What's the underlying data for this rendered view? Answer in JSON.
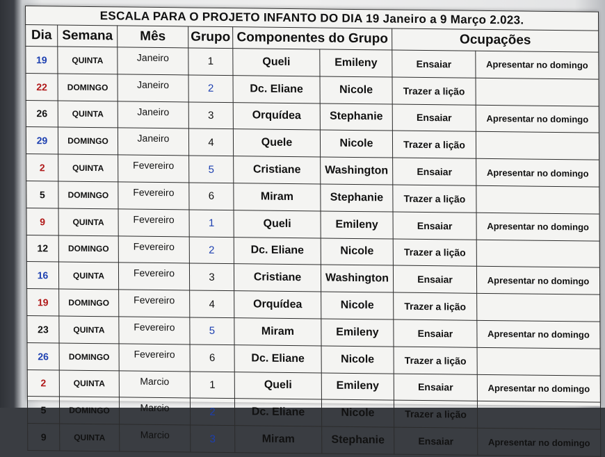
{
  "title": "ESCALA PARA O PROJETO INFANTO DO DIA 19 Janeiro a 9 Março 2.023.",
  "headers": {
    "dia": "Dia",
    "semana": "Semana",
    "mes": "Mês",
    "grupo": "Grupo",
    "componentes": "Componentes do Grupo",
    "ocupacoes": "Ocupações"
  },
  "rows": [
    {
      "dia": "19",
      "dia_color": "blue",
      "semana": "QUINTA",
      "mes": "Janeiro",
      "grupo": "1",
      "grupo_color": "black",
      "comp1": "Queli",
      "comp2": "Emileny",
      "acao": "Ensaiar",
      "apresentar": "Apresentar no domingo"
    },
    {
      "dia": "22",
      "dia_color": "red",
      "semana": "DOMINGO",
      "mes": "Janeiro",
      "grupo": "2",
      "grupo_color": "blue",
      "comp1": "Dc. Eliane",
      "comp2": "Nicole",
      "acao": "Trazer a lição",
      "apresentar": ""
    },
    {
      "dia": "26",
      "dia_color": "black",
      "semana": "QUINTA",
      "mes": "Janeiro",
      "grupo": "3",
      "grupo_color": "black",
      "comp1": "Orquídea",
      "comp2": "Stephanie",
      "acao": "Ensaiar",
      "apresentar": "Apresentar no domingo"
    },
    {
      "dia": "29",
      "dia_color": "blue",
      "semana": "DOMINGO",
      "mes": "Janeiro",
      "grupo": "4",
      "grupo_color": "black",
      "comp1": "Quele",
      "comp2": "Nicole",
      "acao": "Trazer a lição",
      "apresentar": ""
    },
    {
      "dia": "2",
      "dia_color": "red",
      "semana": "QUINTA",
      "mes": "Fevereiro",
      "grupo": "5",
      "grupo_color": "blue",
      "comp1": "Cristiane",
      "comp2": "Washington",
      "acao": "Ensaiar",
      "apresentar": "Apresentar no domingo"
    },
    {
      "dia": "5",
      "dia_color": "black",
      "semana": "DOMINGO",
      "mes": "Fevereiro",
      "grupo": "6",
      "grupo_color": "black",
      "comp1": "Miram",
      "comp2": "Stephanie",
      "acao": "Trazer a lição",
      "apresentar": ""
    },
    {
      "dia": "9",
      "dia_color": "red",
      "semana": "QUINTA",
      "mes": "Fevereiro",
      "grupo": "1",
      "grupo_color": "blue",
      "comp1": "Queli",
      "comp2": "Emileny",
      "acao": "Ensaiar",
      "apresentar": "Apresentar no domingo"
    },
    {
      "dia": "12",
      "dia_color": "black",
      "semana": "DOMINGO",
      "mes": "Fevereiro",
      "grupo": "2",
      "grupo_color": "blue",
      "comp1": "Dc. Eliane",
      "comp2": "Nicole",
      "acao": "Trazer a lição",
      "apresentar": ""
    },
    {
      "dia": "16",
      "dia_color": "blue",
      "semana": "QUINTA",
      "mes": "Fevereiro",
      "grupo": "3",
      "grupo_color": "black",
      "comp1": "Cristiane",
      "comp2": "Washington",
      "acao": "Ensaiar",
      "apresentar": "Apresentar no domingo"
    },
    {
      "dia": "19",
      "dia_color": "red",
      "semana": "DOMINGO",
      "mes": "Fevereiro",
      "grupo": "4",
      "grupo_color": "black",
      "comp1": "Orquídea",
      "comp2": "Nicole",
      "acao": "Trazer a lição",
      "apresentar": ""
    },
    {
      "dia": "23",
      "dia_color": "black",
      "semana": "QUINTA",
      "mes": "Fevereiro",
      "grupo": "5",
      "grupo_color": "blue",
      "comp1": "Miram",
      "comp2": "Emileny",
      "acao": "Ensaiar",
      "apresentar": "Apresentar no domingo"
    },
    {
      "dia": "26",
      "dia_color": "blue",
      "semana": "DOMINGO",
      "mes": "Fevereiro",
      "grupo": "6",
      "grupo_color": "black",
      "comp1": "Dc. Eliane",
      "comp2": "Nicole",
      "acao": "Trazer a lição",
      "apresentar": ""
    },
    {
      "dia": "2",
      "dia_color": "red",
      "semana": "QUINTA",
      "mes": "Marcio",
      "grupo": "1",
      "grupo_color": "black",
      "comp1": "Queli",
      "comp2": "Emileny",
      "acao": "Ensaiar",
      "apresentar": "Apresentar no domingo"
    },
    {
      "dia": "5",
      "dia_color": "black",
      "semana": "DOMINGO",
      "mes": "Marcio",
      "grupo": "2",
      "grupo_color": "blue",
      "comp1": "Dc. Eliane",
      "comp2": "Nicole",
      "acao": "Trazer a lição",
      "apresentar": ""
    },
    {
      "dia": "9",
      "dia_color": "black",
      "semana": "QUINTA",
      "mes": "Marcio",
      "grupo": "3",
      "grupo_color": "blue",
      "comp1": "Miram",
      "comp2": "Stephanie",
      "acao": "Ensaiar",
      "apresentar": "Apresentar no domingo"
    }
  ]
}
